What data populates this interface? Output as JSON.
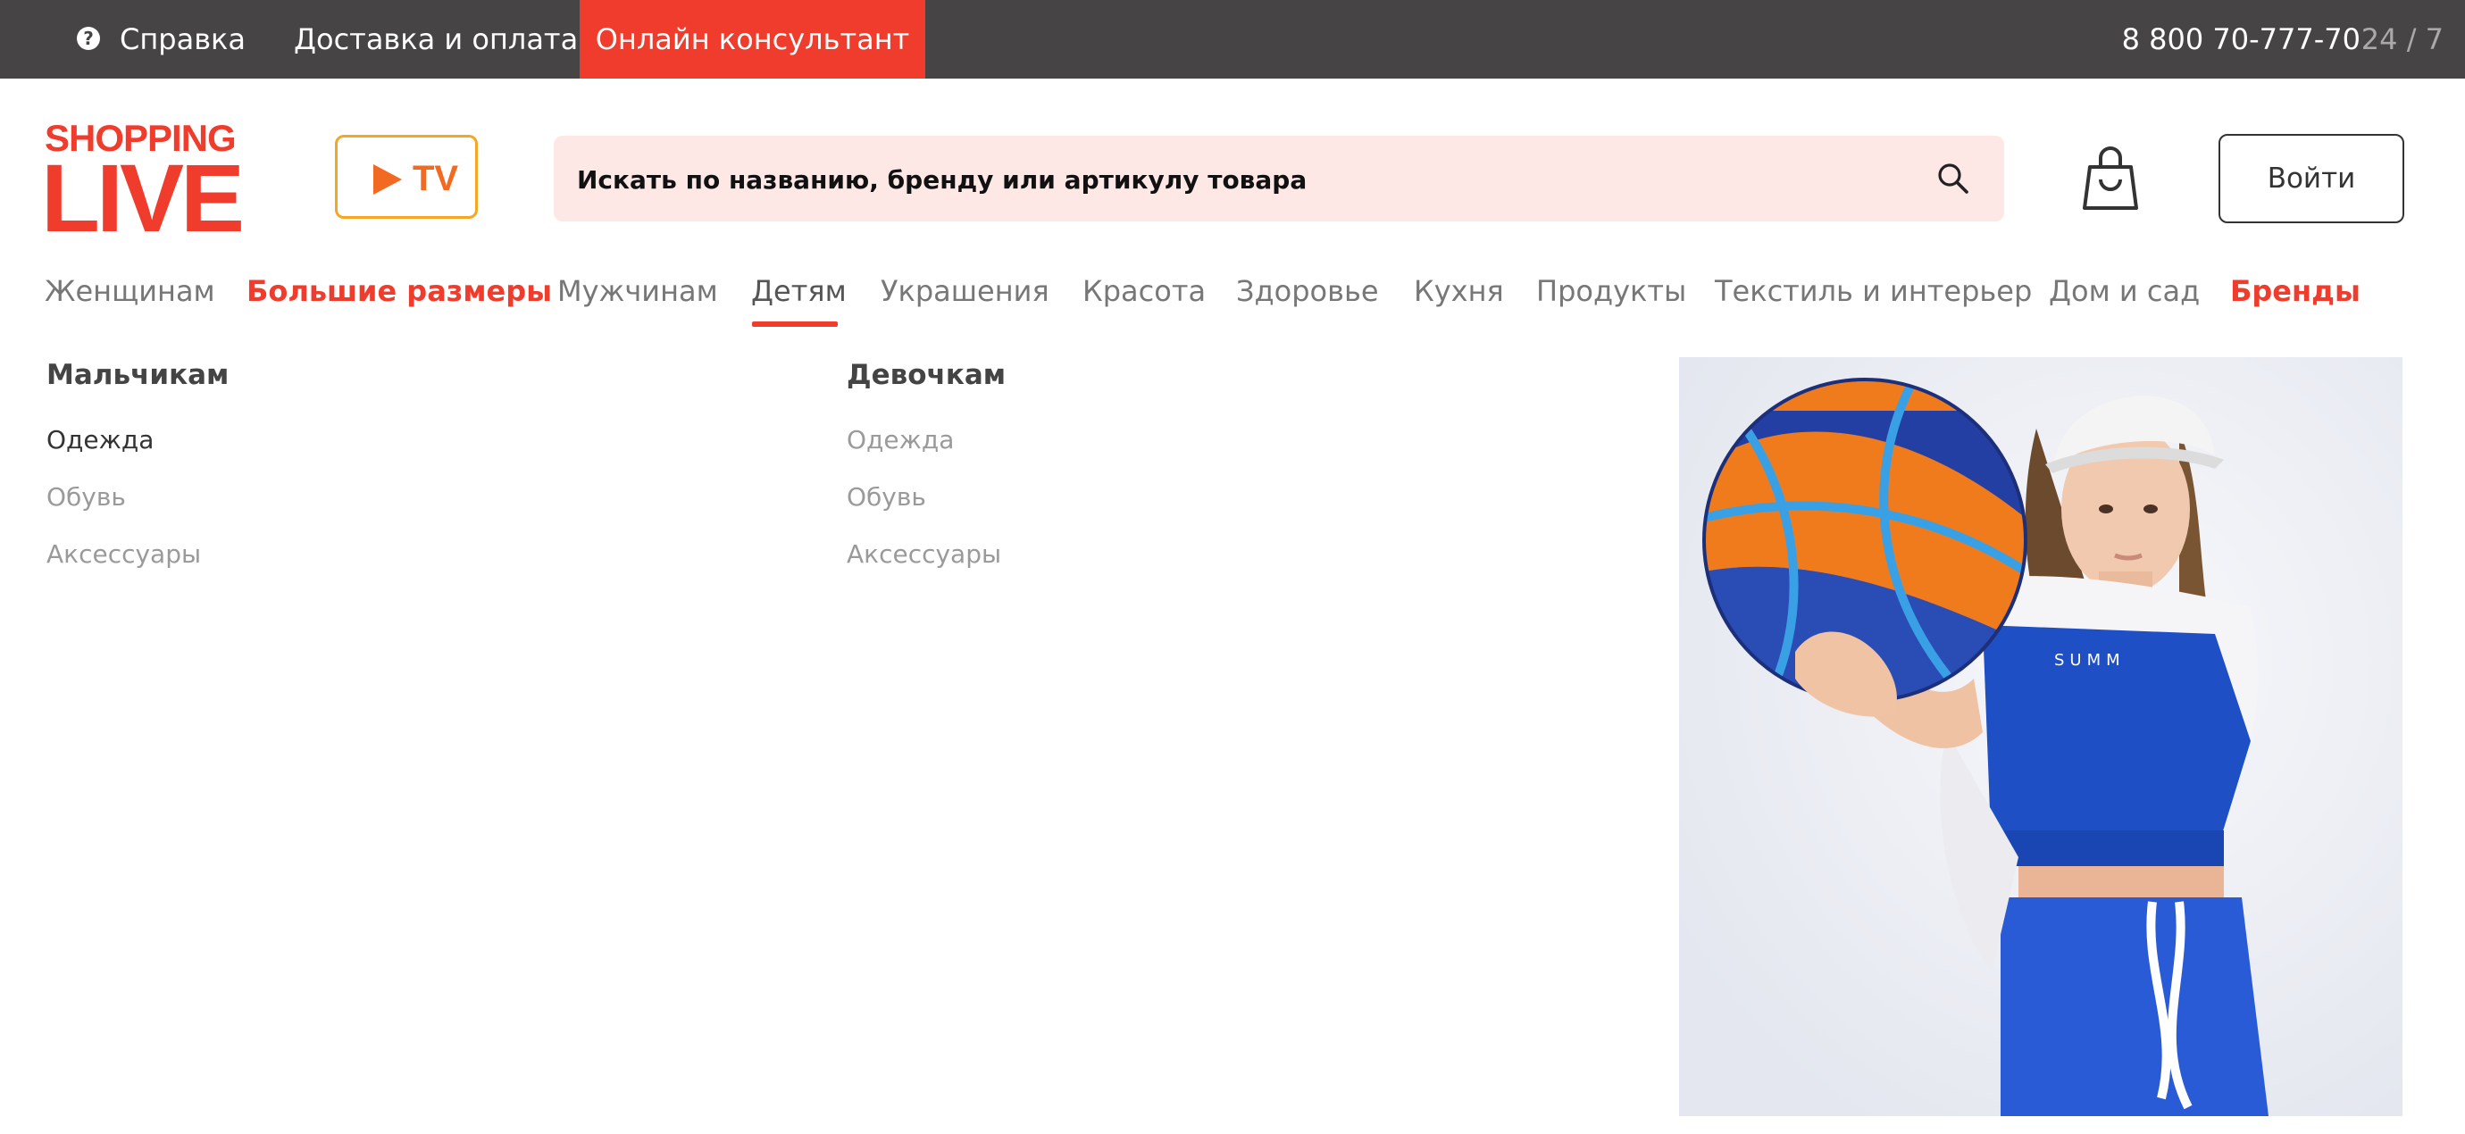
{
  "topbar": {
    "help_label": "Справка",
    "help_icon": "question-circle-icon",
    "delivery_label": "Доставка и оплата",
    "consultant_label": "Онлайн консультант",
    "phone": "8 800 70-777-70",
    "hours": "24 / 7"
  },
  "header": {
    "logo_line1": "SHOPPING",
    "logo_line2": "LIVE",
    "tv_label": "TV",
    "search_placeholder": "Искать по названию, бренду или артикулу товара",
    "search_icon": "search-icon",
    "cart_icon": "shopping-bag-icon",
    "login_label": "Войти"
  },
  "nav": {
    "items": [
      {
        "label": "Женщинам"
      },
      {
        "label": "Большие размеры"
      },
      {
        "label": "Мужчинам"
      },
      {
        "label": "Детям"
      },
      {
        "label": "Украшения"
      },
      {
        "label": "Красота"
      },
      {
        "label": "Здоровье"
      },
      {
        "label": "Кухня"
      },
      {
        "label": "Продукты"
      },
      {
        "label": "Текстиль и интерьер"
      },
      {
        "label": "Дом и сад"
      },
      {
        "label": "Бренды"
      }
    ],
    "active": "Детям"
  },
  "dropdown": {
    "columns": [
      {
        "title": "Мальчикам",
        "links": [
          "Одежда",
          "Обувь",
          "Аксессуары"
        ]
      },
      {
        "title": "Девочкам",
        "links": [
          "Одежда",
          "Обувь",
          "Аксессуары"
        ]
      }
    ]
  },
  "colors": {
    "brand_red": "#f03c2c",
    "topbar_bg": "#464444",
    "search_bg": "#fde8e6",
    "tv_border": "#f5a623"
  }
}
